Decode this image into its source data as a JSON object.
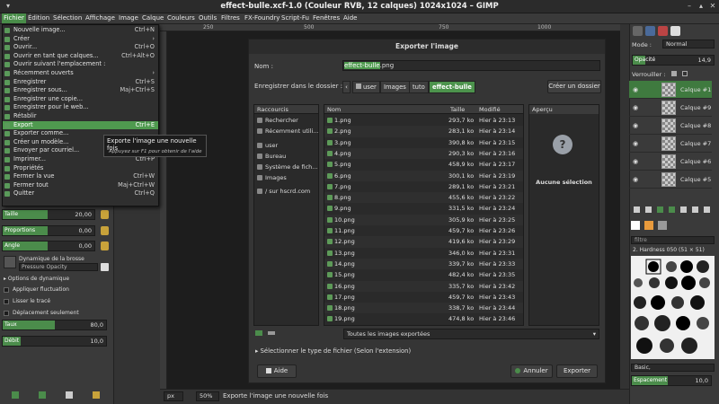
{
  "window": {
    "title": "effect-bulle.xcf-1.0 (Couleur RVB, 12 calques) 1024x1024 – GIMP"
  },
  "menubar": [
    "Fichier",
    "Édition",
    "Sélection",
    "Affichage",
    "Image",
    "Calque",
    "Couleurs",
    "Outils",
    "Filtres",
    "FX-Foundry",
    "Script-Fu",
    "Fenêtres",
    "Aide"
  ],
  "file_menu": [
    {
      "label": "Nouvelle image...",
      "accel": "Ctrl+N"
    },
    {
      "label": "Créer",
      "accel": "›"
    },
    {
      "label": "Ouvrir...",
      "accel": "Ctrl+O"
    },
    {
      "label": "Ouvrir en tant que calques...",
      "accel": "Ctrl+Alt+O"
    },
    {
      "label": "Ouvrir suivant l'emplacement :",
      "accel": ""
    },
    {
      "label": "Récemment ouverts",
      "accel": "›"
    },
    {
      "label": "Enregistrer",
      "accel": "Ctrl+S"
    },
    {
      "label": "Enregistrer sous...",
      "accel": "Maj+Ctrl+S"
    },
    {
      "label": "Enregistrer une copie...",
      "accel": ""
    },
    {
      "label": "Enregistrer pour le web...",
      "accel": ""
    },
    {
      "label": "Rétablir",
      "accel": ""
    },
    {
      "label": "Export",
      "accel": "Ctrl+E"
    },
    {
      "label": "Exporter comme...",
      "accel": ""
    },
    {
      "label": "Créer un modèle...",
      "accel": ""
    },
    {
      "label": "Envoyer par courriel...",
      "accel": ""
    },
    {
      "label": "Imprimer...",
      "accel": "Ctrl+P"
    },
    {
      "label": "Propriétés",
      "accel": ""
    },
    {
      "label": "Fermer la vue",
      "accel": "Ctrl+W"
    },
    {
      "label": "Fermer tout",
      "accel": "Maj+Ctrl+W"
    },
    {
      "label": "Quitter",
      "accel": "Ctrl+Q"
    }
  ],
  "tooltip": {
    "line1": "Exporte l'image une nouvelle fois",
    "line2": "Appuyez sur F1 pour obtenir de l'aide"
  },
  "tool_options": {
    "size": {
      "label": "Taille",
      "value": "20,00"
    },
    "ratio": {
      "label": "Proportions",
      "value": "0,00"
    },
    "angle": {
      "label": "Angle",
      "value": "0,00"
    },
    "dynamics_title": "Dynamique de la brosse",
    "dynamics_value": "Pressure Opacity",
    "dynamics_options": "Options de dynamique",
    "apply_jitter": "Appliquer fluctuation",
    "smooth": "Lisser le tracé",
    "incremental": "Déplacement seulement",
    "rate": {
      "label": "Taux",
      "value": "80,0"
    },
    "flow": {
      "label": "Débit",
      "value": "10,0"
    }
  },
  "ruler_ticks": [
    "250",
    "500",
    "750",
    "1000"
  ],
  "dialog": {
    "title": "Exporter l'image",
    "name_label": "Nom :",
    "name_value_sel": "effect-bulle",
    "name_value_rest": ".png",
    "save_in_label": "Enregistrer dans le dossier :",
    "path": [
      "user",
      "Images",
      "tuto",
      "effect-bulle"
    ],
    "create_folder": "Créer un dossier",
    "places_header": "Raccourcis",
    "places": [
      "Rechercher",
      "Récemment utili...",
      "user",
      "Bureau",
      "Système de fich...",
      "Images",
      "/ sur hscrd.com"
    ],
    "col_name": "Nom",
    "col_size": "Taille",
    "col_modified": "Modifié",
    "files": [
      {
        "name": "1.png",
        "size": "293,7 ko",
        "date": "Hier à 23:13"
      },
      {
        "name": "2.png",
        "size": "283,1 ko",
        "date": "Hier à 23:14"
      },
      {
        "name": "3.png",
        "size": "390,8 ko",
        "date": "Hier à 23:15"
      },
      {
        "name": "4.png",
        "size": "290,3 ko",
        "date": "Hier à 23:16"
      },
      {
        "name": "5.png",
        "size": "458,9 ko",
        "date": "Hier à 23:17"
      },
      {
        "name": "6.png",
        "size": "300,1 ko",
        "date": "Hier à 23:19"
      },
      {
        "name": "7.png",
        "size": "289,1 ko",
        "date": "Hier à 23:21"
      },
      {
        "name": "8.png",
        "size": "455,6 ko",
        "date": "Hier à 23:22"
      },
      {
        "name": "9.png",
        "size": "331,5 ko",
        "date": "Hier à 23:24"
      },
      {
        "name": "10.png",
        "size": "305,9 ko",
        "date": "Hier à 23:25"
      },
      {
        "name": "11.png",
        "size": "459,7 ko",
        "date": "Hier à 23:26"
      },
      {
        "name": "12.png",
        "size": "419,6 ko",
        "date": "Hier à 23:29"
      },
      {
        "name": "13.png",
        "size": "346,0 ko",
        "date": "Hier à 23:31"
      },
      {
        "name": "14.png",
        "size": "339,7 ko",
        "date": "Hier à 23:33"
      },
      {
        "name": "15.png",
        "size": "482,4 ko",
        "date": "Hier à 23:35"
      },
      {
        "name": "16.png",
        "size": "335,7 ko",
        "date": "Hier à 23:42"
      },
      {
        "name": "17.png",
        "size": "459,7 ko",
        "date": "Hier à 23:43"
      },
      {
        "name": "18.png",
        "size": "338,7 ko",
        "date": "Hier à 23:44"
      },
      {
        "name": "19.png",
        "size": "474,8 ko",
        "date": "Hier à 23:46"
      }
    ],
    "preview_header": "Aperçu",
    "preview_none": "Aucune sélection",
    "filter": "Toutes les images exportées",
    "file_type": "Sélectionner le type de fichier (Selon l'extension)",
    "help": "Aide",
    "cancel": "Annuler",
    "export": "Exporter"
  },
  "right_dock": {
    "mode_label": "Mode :",
    "mode_value": "Normal",
    "opacity_label": "Opacité",
    "opacity_value": "14,9",
    "lock_label": "Verrouiller :",
    "layers": [
      "Calque #1",
      "Calque #9",
      "Calque #8",
      "Calque #7",
      "Calque #6",
      "Calque #5"
    ],
    "brush_filter": "filtre",
    "brush_name": "2. Hardness 050 (51 × 51)",
    "brush_tag": "Basic,",
    "spacing_label": "Espacement",
    "spacing_value": "10,0"
  },
  "status": {
    "unit": "px",
    "zoom": "50%",
    "message": "Exporte l'image une nouvelle fois"
  },
  "colors": {
    "accent": "#4f9a4f",
    "bg": "#333333"
  }
}
